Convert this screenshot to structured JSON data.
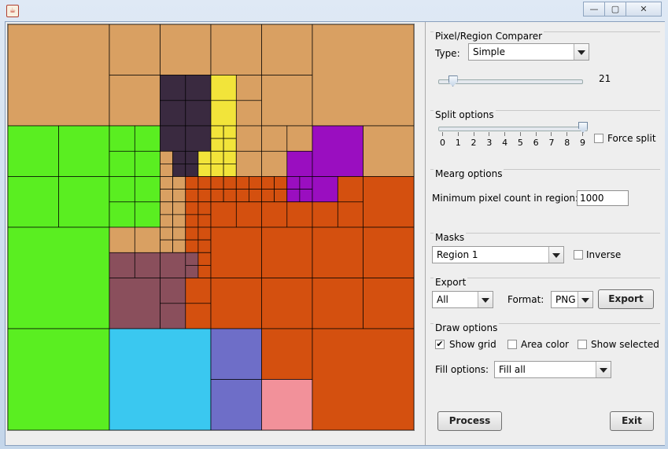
{
  "window": {
    "icon": "java-icon",
    "controls": [
      "minimize-icon",
      "maximize-icon",
      "close-icon"
    ]
  },
  "canvas": {
    "description_colors": {
      "tan": "#d9a062",
      "green": "#5aee21",
      "orange": "#d4500f",
      "purple": "#9a0ec0",
      "brown": "#8a4f5c",
      "cyan": "#3ac8f0",
      "slate": "#6e6ec8",
      "pink": "#f2919a",
      "yellow": "#f2e43a",
      "dark": "#3a2a40",
      "red": "#d21f2a",
      "grid": "#000000"
    }
  },
  "comparer": {
    "title": "Pixel/Region Comparer",
    "type_label": "Type:",
    "type_value": "Simple",
    "slider_value": "21",
    "slider_level": 0.08
  },
  "split": {
    "title": "Split options",
    "ticks": [
      "0",
      "1",
      "2",
      "3",
      "4",
      "5",
      "6",
      "7",
      "8",
      "9"
    ],
    "value": 9,
    "force_label": "Force split",
    "force_checked": false
  },
  "merge": {
    "title": "Mearg options",
    "min_label": "Minimum pixel count in region:",
    "min_value": "1000"
  },
  "masks": {
    "title": "Masks",
    "region_value": "Region 1",
    "inverse_label": "Inverse",
    "inverse_checked": false
  },
  "export": {
    "title": "Export",
    "scope_value": "All",
    "format_label": "Format:",
    "format_value": "PNG",
    "export_button": "Export"
  },
  "draw": {
    "title": "Draw options",
    "show_grid_label": "Show grid",
    "show_grid_checked": true,
    "area_color_label": "Area color",
    "area_color_checked": false,
    "show_selected_label": "Show selected",
    "show_selected_checked": false,
    "fill_label": "Fill options:",
    "fill_value": "Fill all"
  },
  "actions": {
    "process_button": "Process",
    "exit_button": "Exit"
  }
}
